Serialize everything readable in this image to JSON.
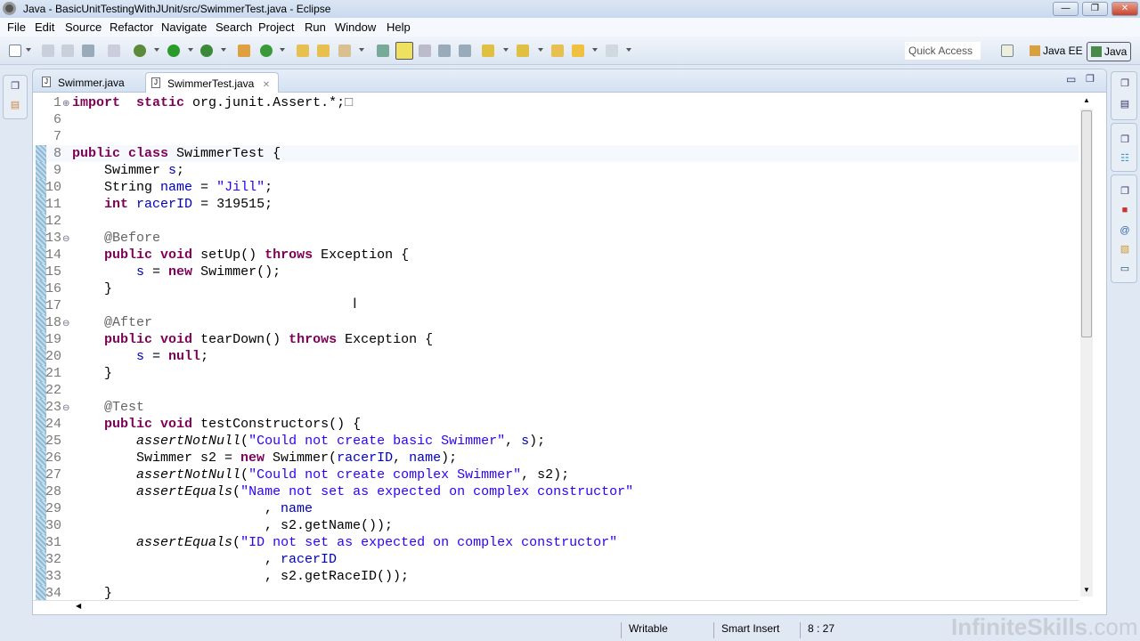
{
  "window": {
    "title": "Java - BasicUnitTestingWithJUnit/src/SwimmerTest.java - Eclipse",
    "minimize": "—",
    "restore": "❐",
    "close": "✕"
  },
  "menu": [
    "File",
    "Edit",
    "Source",
    "Refactor",
    "Navigate",
    "Search",
    "Project",
    "Run",
    "Window",
    "Help"
  ],
  "toolbar": {
    "quick_access_placeholder": "Quick Access",
    "perspectives": [
      "Java EE",
      "Java"
    ],
    "active_perspective": "Java"
  },
  "tabs": [
    {
      "label": "Swimmer.java",
      "active": false
    },
    {
      "label": "SwimmerTest.java",
      "active": true,
      "close": "✕"
    }
  ],
  "editor": {
    "current_line": 8,
    "lines": [
      {
        "n": "1",
        "fold": "⊕",
        "t": [
          [
            "kw",
            "import"
          ],
          [
            "",
            "  "
          ],
          [
            "kw",
            "static"
          ],
          [
            "",
            " org.junit.Assert.*;"
          ],
          [
            "ann",
            "□"
          ]
        ]
      },
      {
        "n": "6",
        "t": []
      },
      {
        "n": "7",
        "t": []
      },
      {
        "n": "8",
        "t": [
          [
            "kw",
            "public"
          ],
          [
            "",
            " "
          ],
          [
            "kw",
            "class"
          ],
          [
            "",
            " SwimmerTest {"
          ]
        ]
      },
      {
        "n": "9",
        "t": [
          [
            "",
            "    Swimmer "
          ],
          [
            "fld",
            "s"
          ],
          [
            "",
            ";"
          ]
        ]
      },
      {
        "n": "10",
        "t": [
          [
            "",
            "    String "
          ],
          [
            "fld",
            "name"
          ],
          [
            "",
            " = "
          ],
          [
            "str",
            "\"Jill\""
          ],
          [
            "",
            ";"
          ]
        ]
      },
      {
        "n": "11",
        "t": [
          [
            "",
            "    "
          ],
          [
            "kw",
            "int"
          ],
          [
            "",
            " "
          ],
          [
            "fld",
            "racerID"
          ],
          [
            "",
            " = 319515;"
          ]
        ]
      },
      {
        "n": "12",
        "t": []
      },
      {
        "n": "13",
        "fold": "⊖",
        "t": [
          [
            "",
            "    "
          ],
          [
            "ann",
            "@Before"
          ]
        ]
      },
      {
        "n": "14",
        "t": [
          [
            "",
            "    "
          ],
          [
            "kw",
            "public"
          ],
          [
            "",
            " "
          ],
          [
            "kw",
            "void"
          ],
          [
            "",
            " setUp() "
          ],
          [
            "kw",
            "throws"
          ],
          [
            "",
            " Exception {"
          ]
        ]
      },
      {
        "n": "15",
        "t": [
          [
            "",
            "        "
          ],
          [
            "fld",
            "s"
          ],
          [
            "",
            " = "
          ],
          [
            "kw",
            "new"
          ],
          [
            "",
            " Swimmer();"
          ]
        ]
      },
      {
        "n": "16",
        "t": [
          [
            "",
            "    }"
          ]
        ]
      },
      {
        "n": "17",
        "t": []
      },
      {
        "n": "18",
        "fold": "⊖",
        "t": [
          [
            "",
            "    "
          ],
          [
            "ann",
            "@After"
          ]
        ]
      },
      {
        "n": "19",
        "t": [
          [
            "",
            "    "
          ],
          [
            "kw",
            "public"
          ],
          [
            "",
            " "
          ],
          [
            "kw",
            "void"
          ],
          [
            "",
            " tearDown() "
          ],
          [
            "kw",
            "throws"
          ],
          [
            "",
            " Exception {"
          ]
        ]
      },
      {
        "n": "20",
        "t": [
          [
            "",
            "        "
          ],
          [
            "fld",
            "s"
          ],
          [
            "",
            " = "
          ],
          [
            "kw",
            "null"
          ],
          [
            "",
            ";"
          ]
        ]
      },
      {
        "n": "21",
        "t": [
          [
            "",
            "    }"
          ]
        ]
      },
      {
        "n": "22",
        "t": []
      },
      {
        "n": "23",
        "fold": "⊖",
        "t": [
          [
            "",
            "    "
          ],
          [
            "ann",
            "@Test"
          ]
        ]
      },
      {
        "n": "24",
        "t": [
          [
            "",
            "    "
          ],
          [
            "kw",
            "public"
          ],
          [
            "",
            " "
          ],
          [
            "kw",
            "void"
          ],
          [
            "",
            " testConstructors() {"
          ]
        ]
      },
      {
        "n": "25",
        "t": [
          [
            "",
            "        "
          ],
          [
            "ital",
            "assertNotNull"
          ],
          [
            "",
            "("
          ],
          [
            "str",
            "\"Could not create basic Swimmer\""
          ],
          [
            "",
            ", "
          ],
          [
            "fld",
            "s"
          ],
          [
            "",
            ");"
          ]
        ]
      },
      {
        "n": "26",
        "t": [
          [
            "",
            "        Swimmer s2 = "
          ],
          [
            "kw",
            "new"
          ],
          [
            "",
            " Swimmer("
          ],
          [
            "fld",
            "racerID"
          ],
          [
            "",
            ", "
          ],
          [
            "fld",
            "name"
          ],
          [
            "",
            ");"
          ]
        ]
      },
      {
        "n": "27",
        "t": [
          [
            "",
            "        "
          ],
          [
            "ital",
            "assertNotNull"
          ],
          [
            "",
            "("
          ],
          [
            "str",
            "\"Could not create complex Swimmer\""
          ],
          [
            "",
            ", s2);"
          ]
        ]
      },
      {
        "n": "28",
        "t": [
          [
            "",
            "        "
          ],
          [
            "ital",
            "assertEquals"
          ],
          [
            "",
            "("
          ],
          [
            "str",
            "\"Name not set as expected on complex constructor\""
          ]
        ]
      },
      {
        "n": "29",
        "t": [
          [
            "",
            "                        , "
          ],
          [
            "fld",
            "name"
          ]
        ]
      },
      {
        "n": "30",
        "t": [
          [
            "",
            "                        , s2.getName());"
          ]
        ]
      },
      {
        "n": "31",
        "t": [
          [
            "",
            "        "
          ],
          [
            "ital",
            "assertEquals"
          ],
          [
            "",
            "("
          ],
          [
            "str",
            "\"ID not set as expected on complex constructor\""
          ]
        ]
      },
      {
        "n": "32",
        "t": [
          [
            "",
            "                        , "
          ],
          [
            "fld",
            "racerID"
          ]
        ]
      },
      {
        "n": "33",
        "t": [
          [
            "",
            "                        , s2.getRaceID());"
          ]
        ]
      },
      {
        "n": "34",
        "t": [
          [
            "",
            "    }"
          ]
        ]
      }
    ]
  },
  "status": {
    "mode": "Writable",
    "insert": "Smart Insert",
    "position": "8 : 27"
  },
  "watermark": {
    "brand": "InfiniteSkills",
    "suffix": ".com"
  }
}
